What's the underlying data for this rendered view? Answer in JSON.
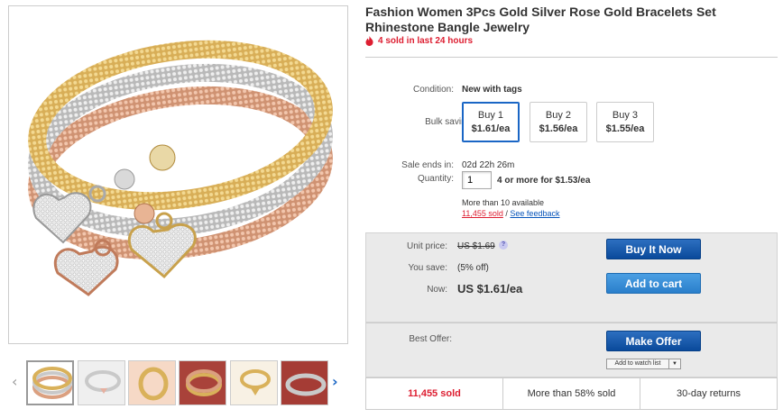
{
  "listing": {
    "title": "Fashion Women 3Pcs Gold Silver Rose Gold Bracelets Set Rhinestone Bangle Jewelry",
    "sold_recent": "4 sold in last 24 hours"
  },
  "details": {
    "condition_label": "Condition:",
    "condition_value": "New with tags",
    "bulk_label": "Bulk savings:",
    "bulk_options": [
      {
        "label": "Buy 1",
        "price": "$1.61/ea"
      },
      {
        "label": "Buy 2",
        "price": "$1.56/ea"
      },
      {
        "label": "Buy 3",
        "price": "$1.55/ea"
      }
    ],
    "sale_label": "Sale ends in:",
    "sale_value": "02d 22h 26m",
    "quantity_label": "Quantity:",
    "quantity_value": "1",
    "quantity_deal": "4 or more for $1.53/ea",
    "available": "More than 10 available",
    "sold_count": "11,455 sold",
    "separator": "/",
    "feedback_link": "See feedback"
  },
  "pricing": {
    "unit_label": "Unit price:",
    "unit_value": "US $1.69",
    "info_icon": "?",
    "save_label": "You save:",
    "save_value": "(5% off)",
    "now_label": "Now:",
    "now_value": "US $1.61/ea"
  },
  "actions": {
    "buy_now": "Buy It Now",
    "add_to_cart": "Add to cart",
    "best_offer_label": "Best Offer:",
    "make_offer": "Make Offer",
    "watch_list": "Add to watch list",
    "watch_arrow": "▼"
  },
  "stats": [
    "11,455 sold",
    "More than 58% sold",
    "30-day returns"
  ],
  "gallery": {
    "prev_arrow": "‹",
    "next_arrow": "›",
    "thumb_count": 6
  },
  "colors": {
    "accent_blue": "#0654ba",
    "alert_red": "#dd1e31",
    "gold": "#d9b15a",
    "silver": "#c9c9c9",
    "rose_gold": "#dba080"
  }
}
